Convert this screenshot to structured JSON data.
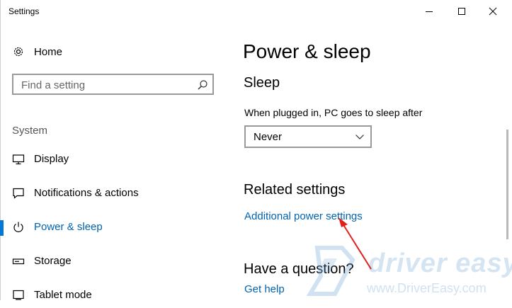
{
  "window": {
    "title": "Settings"
  },
  "sidebar": {
    "home_label": "Home",
    "search_placeholder": "Find a setting",
    "section_label": "System",
    "items": [
      {
        "label": "Display",
        "icon": "monitor-icon"
      },
      {
        "label": "Notifications & actions",
        "icon": "message-icon"
      },
      {
        "label": "Power & sleep",
        "icon": "power-icon",
        "active": true
      },
      {
        "label": "Storage",
        "icon": "storage-icon"
      },
      {
        "label": "Tablet mode",
        "icon": "tablet-icon"
      }
    ]
  },
  "main": {
    "title": "Power & sleep",
    "sleep_heading": "Sleep",
    "sleep_desc": "When plugged in, PC goes to sleep after",
    "sleep_value": "Never",
    "related_heading": "Related settings",
    "related_link": "Additional power settings",
    "question_heading": "Have a question?",
    "help_link": "Get help"
  },
  "watermark": {
    "brand": "driver easy",
    "url": "www.DriverEasy.com"
  },
  "colors": {
    "accent": "#0078d7",
    "link": "#0063b1",
    "arrow": "#e0201b"
  }
}
